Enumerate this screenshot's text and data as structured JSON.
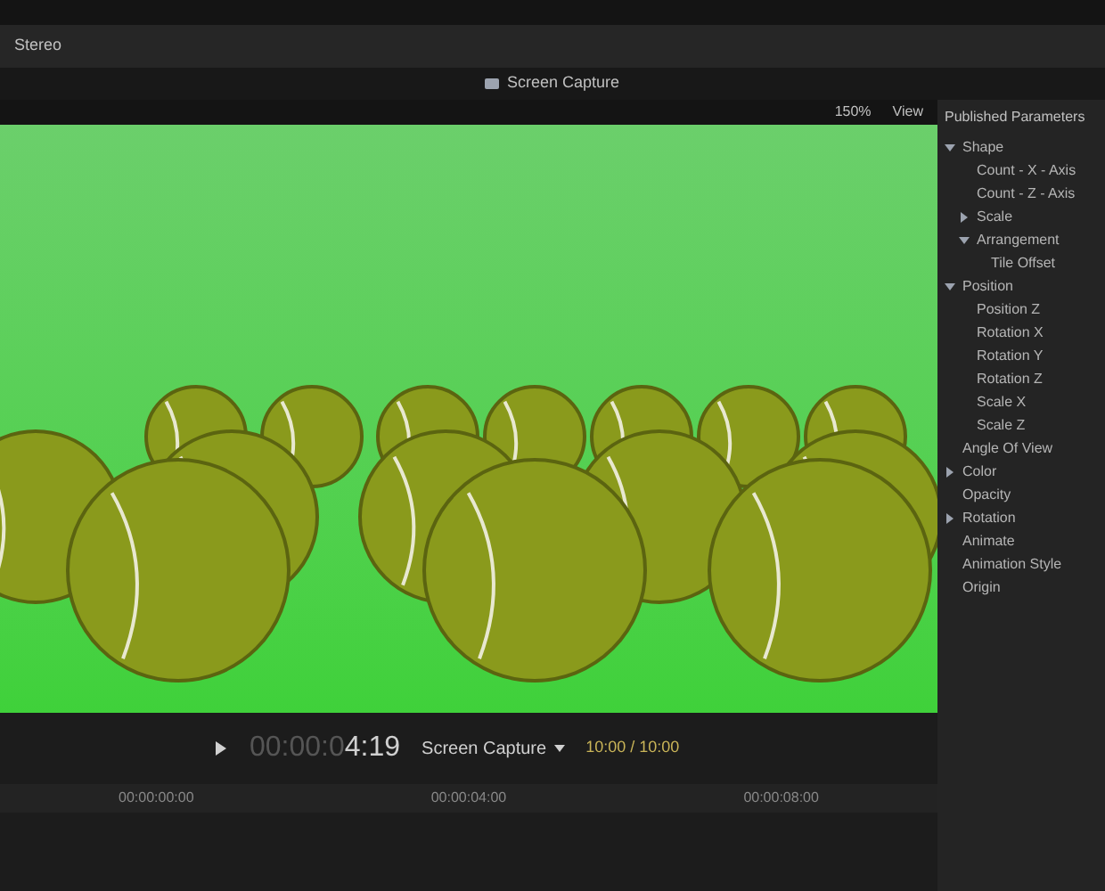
{
  "top_bar": {
    "audio_label": "Stereo"
  },
  "title_bar": {
    "title": "Screen Capture"
  },
  "viewer_toolbar": {
    "zoom": "150%",
    "view": "View"
  },
  "inspector": {
    "title": "Published Parameters",
    "items": [
      {
        "label": "Shape",
        "expanded": true,
        "children": [
          {
            "label": "Count - X - Axis"
          },
          {
            "label": "Count - Z - Axis"
          },
          {
            "label": "Scale",
            "expanded": false
          },
          {
            "label": "Arrangement",
            "expanded": true,
            "children": [
              {
                "label": "Tile Offset"
              }
            ]
          }
        ]
      },
      {
        "label": "Position",
        "expanded": true,
        "children": [
          {
            "label": "Position Z"
          },
          {
            "label": "Rotation X"
          },
          {
            "label": "Rotation Y"
          },
          {
            "label": "Rotation Z"
          },
          {
            "label": "Scale X"
          },
          {
            "label": "Scale Z"
          }
        ]
      },
      {
        "label": "Angle Of View"
      },
      {
        "label": "Color",
        "expanded": false
      },
      {
        "label": "Opacity"
      },
      {
        "label": "Rotation",
        "expanded": false
      },
      {
        "label": "Animate"
      },
      {
        "label": "Animation Style"
      },
      {
        "label": "Origin"
      }
    ]
  },
  "transport": {
    "timecode_dim": "00:00:0",
    "timecode": "4:19",
    "project": "Screen Capture",
    "duration": "10:00 / 10:00"
  },
  "timeline": {
    "ticks": [
      "00:00:00:00",
      "00:00:04:00",
      "00:00:08:00"
    ]
  }
}
